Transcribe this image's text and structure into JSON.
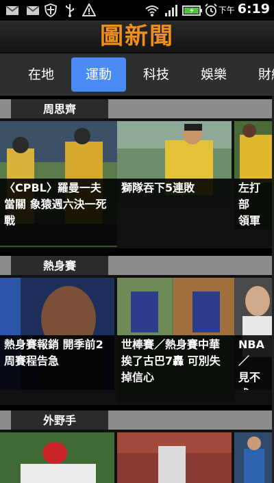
{
  "status_bar": {
    "ampm": "下午",
    "time": "6:19",
    "icons": [
      "gmail-icon",
      "mail-icon",
      "shield-icon",
      "usb-icon",
      "warning-icon",
      "wifi-icon",
      "signal-icon",
      "battery-icon",
      "alarm-icon"
    ]
  },
  "app": {
    "title": "圖新聞"
  },
  "tabs": [
    {
      "label": "在地"
    },
    {
      "label": "運動",
      "active": true
    },
    {
      "label": "科技"
    },
    {
      "label": "娛樂"
    },
    {
      "label": "財經"
    }
  ],
  "sections": [
    {
      "label": "周思齊",
      "cards": [
        {
          "caption": "〈CPBL〉羅曼一夫\n當關 象猿週六決一死\n戰"
        },
        {
          "caption": "獅隊吞下5連敗"
        },
        {
          "caption": "左打部\n領軍兄"
        }
      ]
    },
    {
      "label": "熱身賽",
      "cards": [
        {
          "caption": "熱身賽報銷 開季前2\n周賽程告急"
        },
        {
          "caption": "世棒賽／熱身賽中華\n挨了古巴7轟 可別失\n掉信心"
        },
        {
          "caption": "NBA／\n見不成"
        }
      ]
    },
    {
      "label": "外野手",
      "cards": []
    }
  ],
  "colors": {
    "title_orange": "#f0901a",
    "tab_active": "#4a8bf5",
    "section_band": "#8c8c8c"
  }
}
